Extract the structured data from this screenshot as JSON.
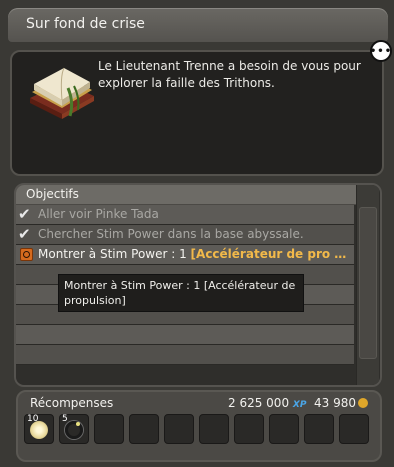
{
  "window": {
    "title": "Sur fond de crise"
  },
  "quest": {
    "description": "Le Lieutenant Trenne a besoin de vous pour explorer la faille des Trithons.",
    "icon": "quest-book-icon"
  },
  "objectives": {
    "header": "Objectifs",
    "items": [
      {
        "done": true,
        "label": "Aller voir Pinke Tada"
      },
      {
        "done": true,
        "label": "Chercher Stim Power dans la base abyssale."
      },
      {
        "done": false,
        "label": "Montrer à Stim Power : 1 ",
        "highlight": "[Accélérateur de pro …"
      }
    ],
    "empty_rows": 5
  },
  "tooltip": {
    "text": "Montrer à Stim Power : 1 [Accélérateur de propulsion]"
  },
  "rewards": {
    "title": "Récompenses",
    "xp_value": "2 625 000",
    "xp_tag": "XP",
    "kamas_value": "43 980",
    "items": [
      {
        "qty": "10",
        "icon": "white-orb-icon"
      },
      {
        "qty": "5",
        "icon": "black-ring-icon"
      }
    ],
    "empty_slots": 8
  },
  "colors": {
    "highlight": "#f2b94a",
    "xp_tag": "#4aa6e8",
    "kamas": "#e0a72a"
  }
}
